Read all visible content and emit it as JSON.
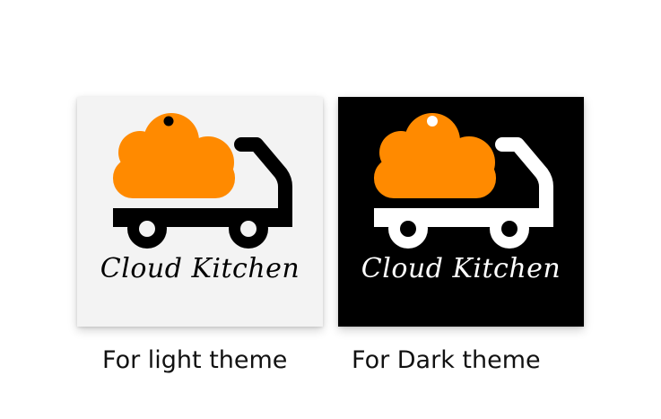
{
  "colors": {
    "accent": "#ff8a00",
    "light_card_bg": "#f3f3f3",
    "dark_card_bg": "#000000",
    "light_logo_fg": "#000000",
    "dark_logo_fg": "#ffffff"
  },
  "cards": [
    {
      "theme": "light",
      "logo_text": "Cloud Kitchen",
      "caption": "For light theme"
    },
    {
      "theme": "dark",
      "logo_text": "Cloud Kitchen",
      "caption": "For Dark theme"
    }
  ]
}
